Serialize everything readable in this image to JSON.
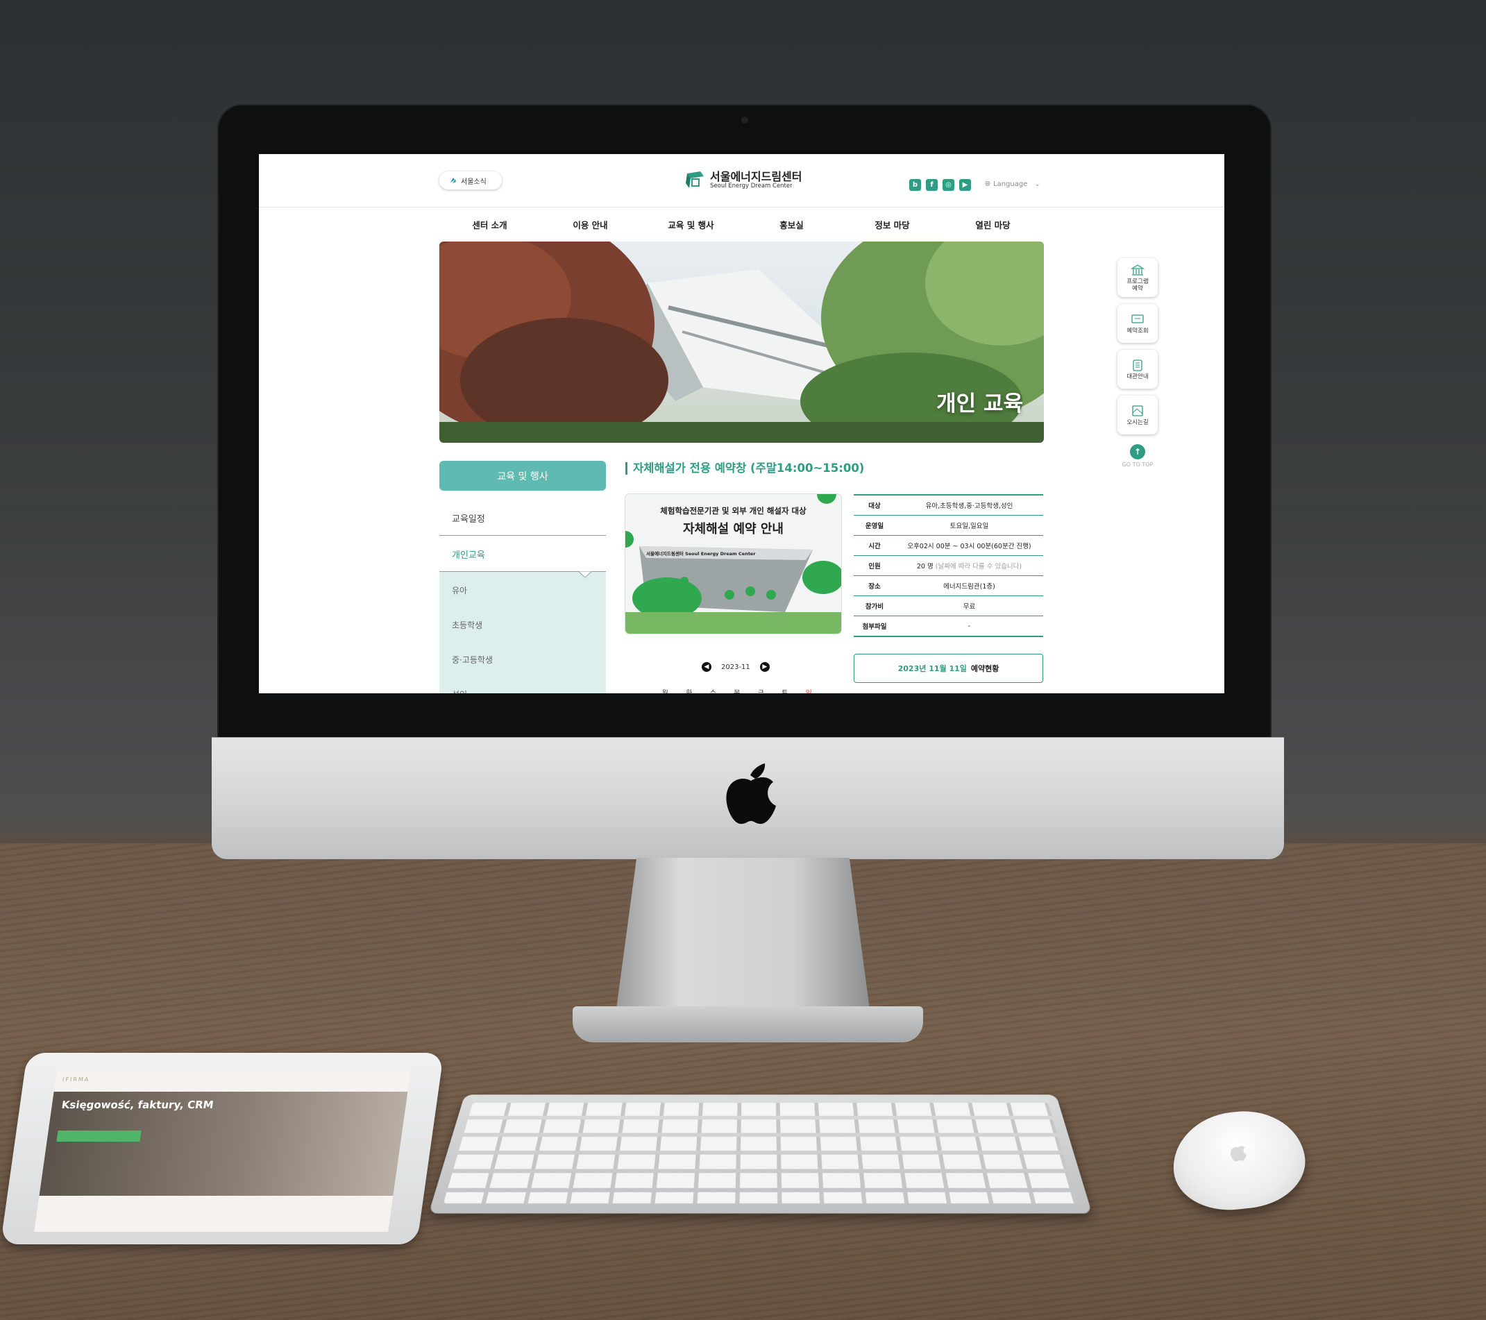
{
  "header": {
    "seoul_news": "서울소식",
    "logo_ko": "서울에너지드림센터",
    "logo_en": "Seoul Energy Dream Center",
    "language": "Language"
  },
  "gnb": [
    "센터 소개",
    "이용 안내",
    "교육 및 행사",
    "홍보실",
    "정보 마당",
    "열린 마당"
  ],
  "banner": {
    "title": "개인 교육"
  },
  "lnb": {
    "head": "교육 및 행사",
    "items": [
      "교육일정",
      "개인교육"
    ],
    "sub": [
      "유아",
      "초등학생",
      "중·고등학생",
      "성인"
    ]
  },
  "section_title": "자체해설가 전용 예약창 (주말14:00~15:00)",
  "poster": {
    "subtitle": "체험학습전문기관 및 외부 개인 해설자 대상",
    "title": "자체해설 예약 안내",
    "building_sign": "서울에너지드림센터 Seoul Energy Dream Center"
  },
  "info": [
    {
      "label": "대상",
      "value": "유아,초등학생,중·고등학생,성인"
    },
    {
      "label": "운영일",
      "value": "토요일,일요일"
    },
    {
      "label": "시간",
      "value": "오후02시 00분 ~ 03시 00분(60분간 진행)"
    },
    {
      "label": "인원",
      "value": "20 명",
      "note": "(날짜에 따라 다를 수 있습니다)"
    },
    {
      "label": "장소",
      "value": "에너지드림관(1층)"
    },
    {
      "label": "참가비",
      "value": "무료"
    },
    {
      "label": "첨부파일",
      "value": "-"
    }
  ],
  "calendar": {
    "month": "2023-11",
    "days": [
      "월",
      "화",
      "수",
      "목",
      "금",
      "토",
      "일"
    ]
  },
  "reservation": {
    "date": "2023년 11월 11일",
    "label": "예약현황"
  },
  "quick_menu": [
    {
      "label": "프로그램 예약",
      "icon": "building-icon"
    },
    {
      "label": "예약조회",
      "icon": "monitor-icon"
    },
    {
      "label": "대관안내",
      "icon": "calendar-icon"
    },
    {
      "label": "오시는길",
      "icon": "map-icon"
    }
  ],
  "go_top": "GO TO TOP",
  "ipad": {
    "brand": "IFIRMA",
    "hero_title": "Księgowość, faktury, CRM"
  },
  "colors": {
    "accent": "#2f9d84",
    "accent_light": "#5fbbb2",
    "submenu_bg": "#dcefed"
  }
}
